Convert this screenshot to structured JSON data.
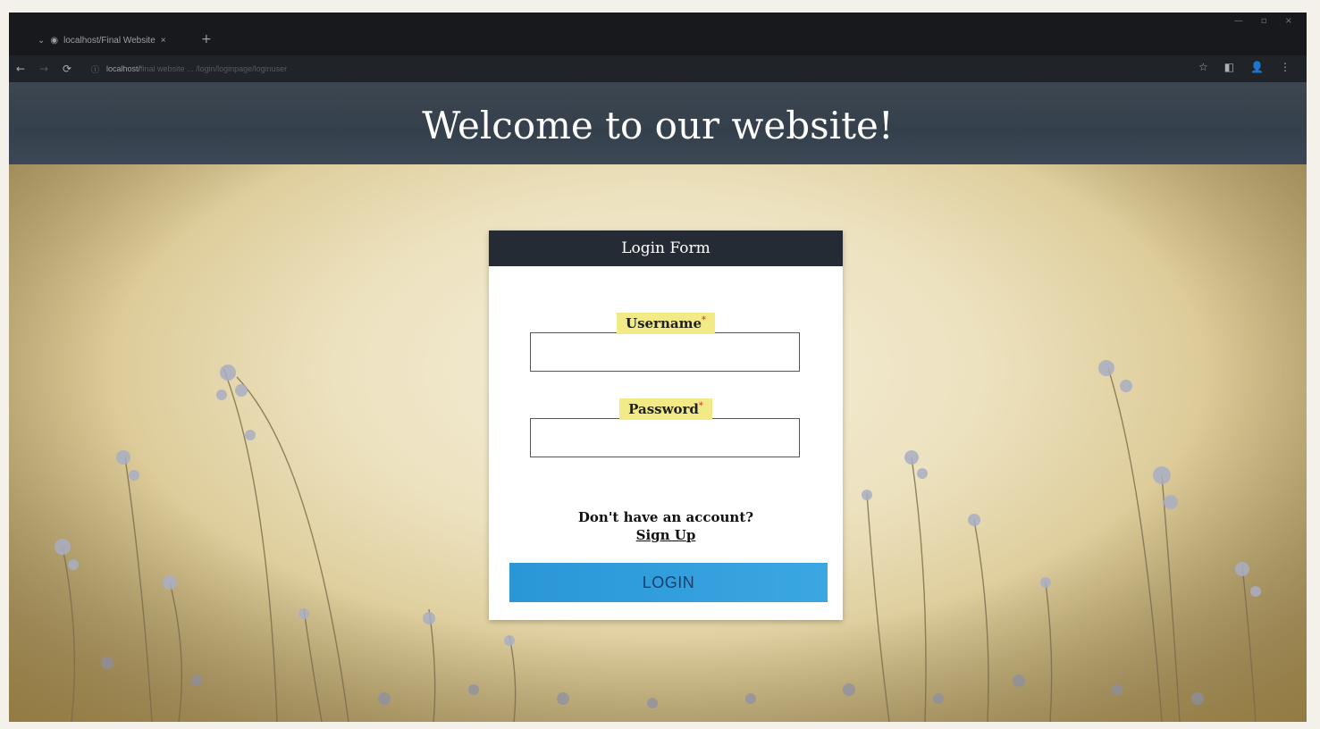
{
  "browser": {
    "tab_title": "localhost/Final Website",
    "tab_close": "×",
    "new_tab": "+",
    "url_host": "localhost/",
    "url_path": "final website ... /login/loginpage/loginuser",
    "win_controls": [
      "—",
      "▫",
      "×"
    ]
  },
  "page": {
    "heading": "Welcome to our website!"
  },
  "login_form": {
    "title": "Login Form",
    "username_label": "Username",
    "password_label": "Password",
    "required_mark": "*",
    "username_value": "",
    "password_value": "",
    "signup_prompt": "Don't have an account?",
    "signup_link": "Sign Up",
    "login_button": "LOGIN"
  },
  "colors": {
    "header_bg": "#3a4450",
    "form_header_bg": "#252b34",
    "label_highlight": "#f1ea86",
    "login_button": "#2a96d6"
  }
}
